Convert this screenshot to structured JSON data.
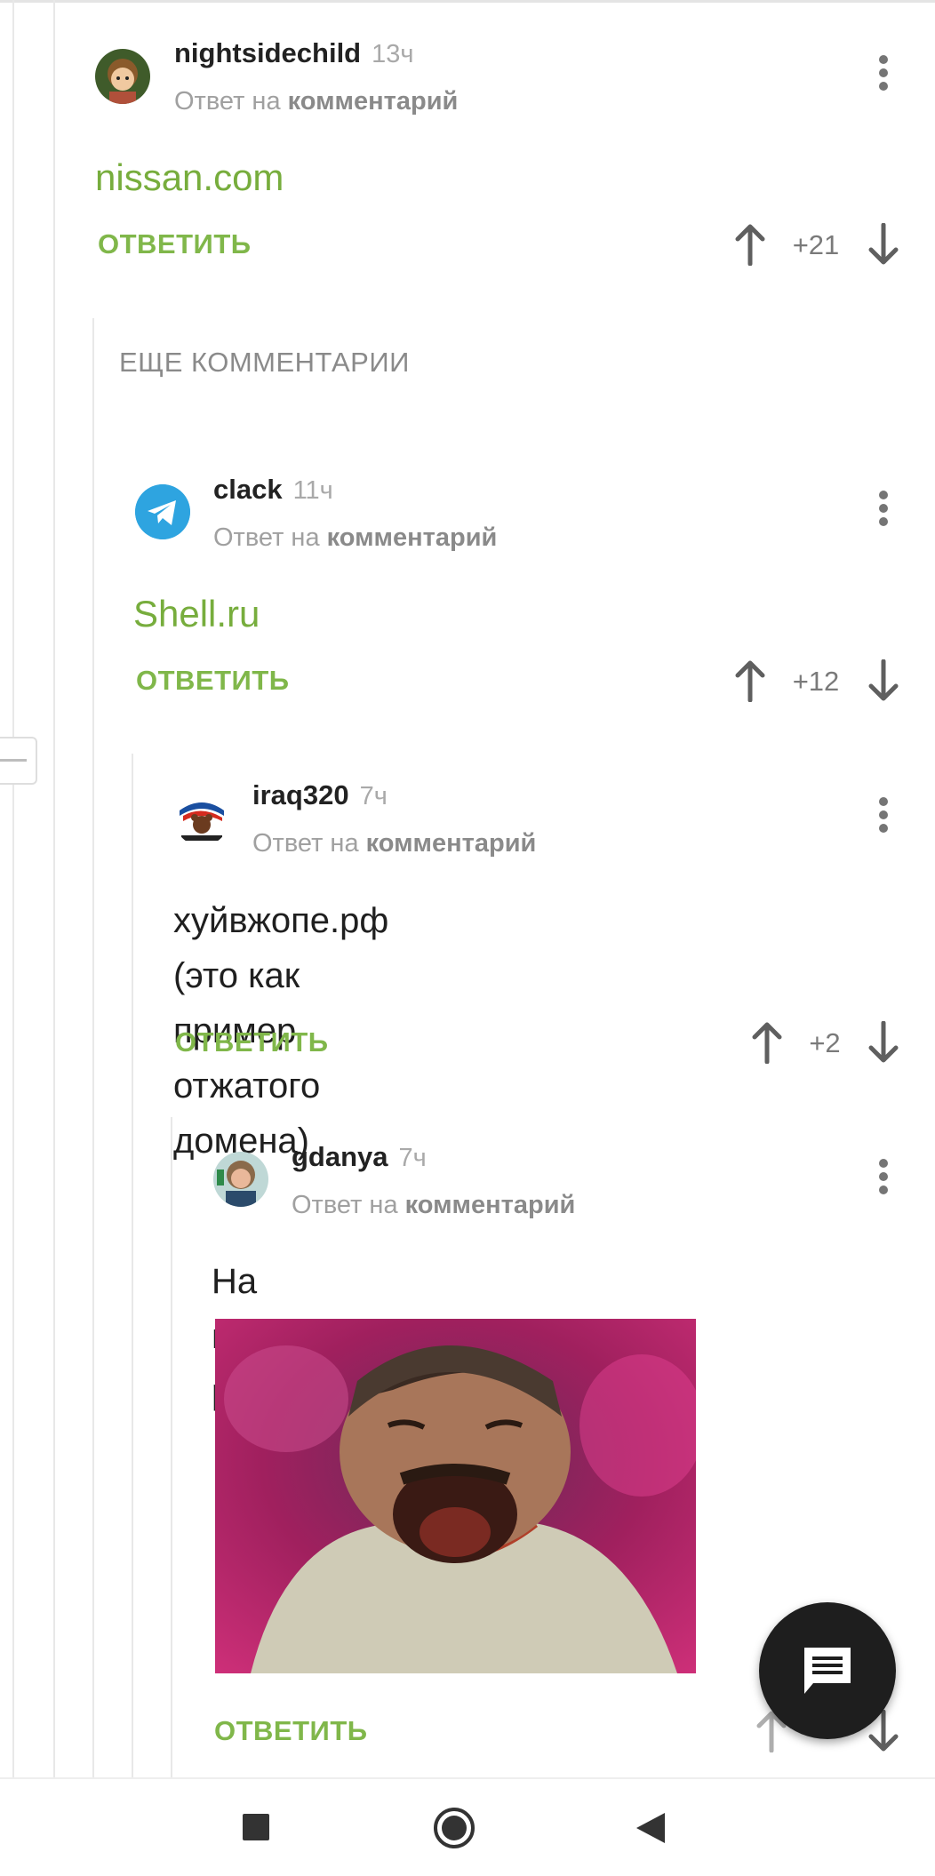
{
  "comments": [
    {
      "author": "nightsidechild",
      "time": "13ч",
      "reply_prefix": "Ответ на",
      "reply_target": "комментарий",
      "text": "nissan.com",
      "reply_label": "ОТВЕТИТЬ",
      "score": "+21"
    },
    {
      "author": "clack",
      "time": "11ч",
      "reply_prefix": "Ответ на",
      "reply_target": "комментарий",
      "text": "Shell.ru",
      "reply_label": "ОТВЕТИТЬ",
      "score": "+12"
    },
    {
      "author": "iraq320",
      "time": "7ч",
      "reply_prefix": "Ответ на",
      "reply_target": "комментарий",
      "text_line1": "хуйвжопе.рф (это как пример",
      "text_line2": "отжатого домена)",
      "reply_label": "ОТВЕТИТЬ",
      "score": "+2"
    },
    {
      "author": "gdanya",
      "time": "7ч",
      "reply_prefix": "Ответ на",
      "reply_target": "комментарий",
      "text": "На госуслуги редиректит",
      "reply_label": "ОТВЕТИТЬ"
    }
  ],
  "more_comments_label": "ЕЩЕ КОММЕНТАРИИ",
  "icons": {
    "vote_up": "arrow-up-icon",
    "vote_down": "arrow-down-icon",
    "menu": "more-vertical-icon",
    "fab": "comment-icon",
    "nav": [
      "square-icon",
      "circle-icon",
      "triangle-back-icon"
    ]
  },
  "colors": {
    "accent": "#80b74a",
    "link": "#77ad3d",
    "fab": "#1e1e1e"
  }
}
